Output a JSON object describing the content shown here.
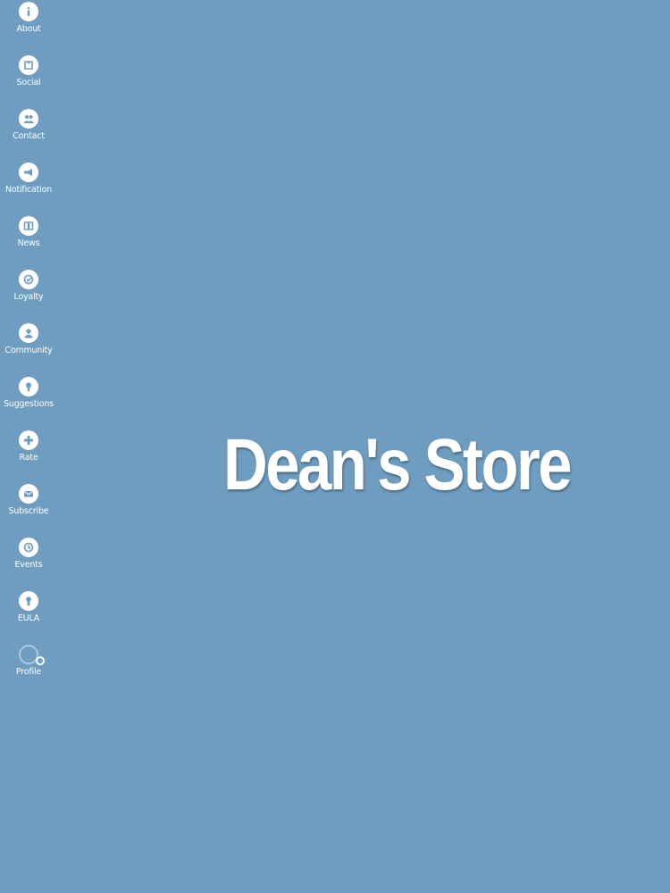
{
  "store": {
    "title": "Dean's Store"
  },
  "sidebar": {
    "items": [
      {
        "label": "About",
        "icon": "info-icon"
      },
      {
        "label": "Social",
        "icon": "social-icon"
      },
      {
        "label": "Contact",
        "icon": "contact-icon"
      },
      {
        "label": "Notification",
        "icon": "megaphone-icon"
      },
      {
        "label": "News",
        "icon": "news-icon"
      },
      {
        "label": "Loyalty",
        "icon": "loyalty-icon"
      },
      {
        "label": "Community",
        "icon": "community-icon"
      },
      {
        "label": "Suggestions",
        "icon": "lightbulb-icon"
      },
      {
        "label": "Rate",
        "icon": "plus-icon"
      },
      {
        "label": "Subscribe",
        "icon": "envelope-icon"
      },
      {
        "label": "Events",
        "icon": "clock-icon"
      },
      {
        "label": "EULA",
        "icon": "document-icon"
      },
      {
        "label": "Profile",
        "icon": "profile-icon"
      }
    ]
  },
  "colors": {
    "background": "#6e9dc0",
    "foreground": "#ffffff"
  }
}
